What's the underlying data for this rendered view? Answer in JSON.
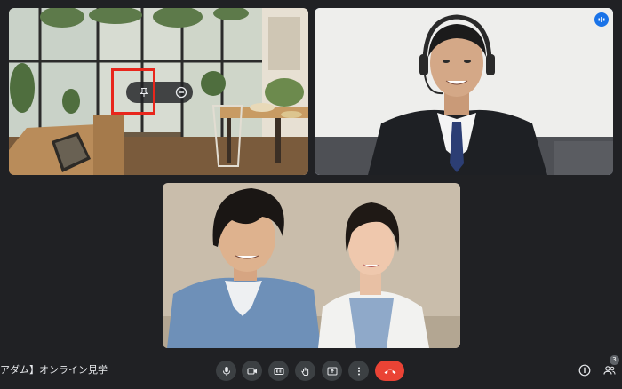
{
  "meeting": {
    "title": "アダム】オンライン見学"
  },
  "participants": {
    "count": "3"
  },
  "icons": {
    "pin": "pin-icon",
    "remove": "remove-circle-icon",
    "speaking": "audio-level-icon",
    "mic": "microphone-icon",
    "camera": "video-camera-icon",
    "captions": "closed-captions-icon",
    "hand": "raise-hand-icon",
    "present": "present-screen-icon",
    "more": "more-vert-icon",
    "end": "end-call-icon",
    "info": "info-icon",
    "people": "people-icon"
  },
  "colors": {
    "background": "#202124",
    "active_speaker_border": "#8ab4f8",
    "end_call": "#ea4335",
    "highlight": "#e8261c",
    "button": "#3c4043"
  }
}
